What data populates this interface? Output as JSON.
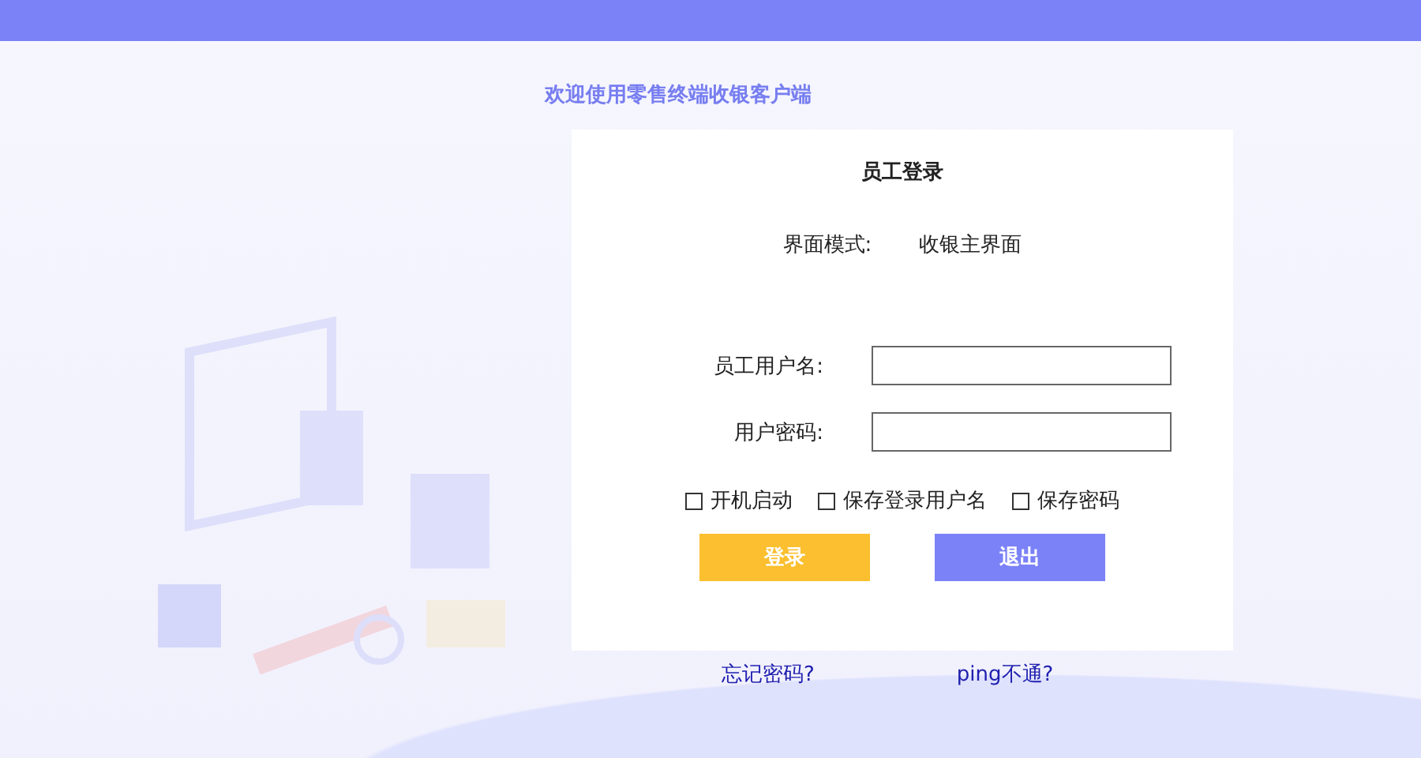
{
  "welcome": "欢迎使用零售终端收银客户端",
  "login": {
    "title": "员工登录",
    "mode_label": "界面模式:",
    "mode_value": "收银主界面",
    "fields": [
      {
        "label": "员工用户名:"
      },
      {
        "label": "用户密码:"
      }
    ],
    "options": [
      {
        "label": "开机启动",
        "checked": false
      },
      {
        "label": "保存登录用户名",
        "checked": false
      },
      {
        "label": "保存密码",
        "checked": false
      }
    ],
    "buttons": [
      {
        "label": "登录",
        "kind": "primary"
      },
      {
        "label": "退出",
        "kind": "secondary"
      }
    ]
  },
  "links": [
    "忘记密码?",
    "ping不通?"
  ]
}
